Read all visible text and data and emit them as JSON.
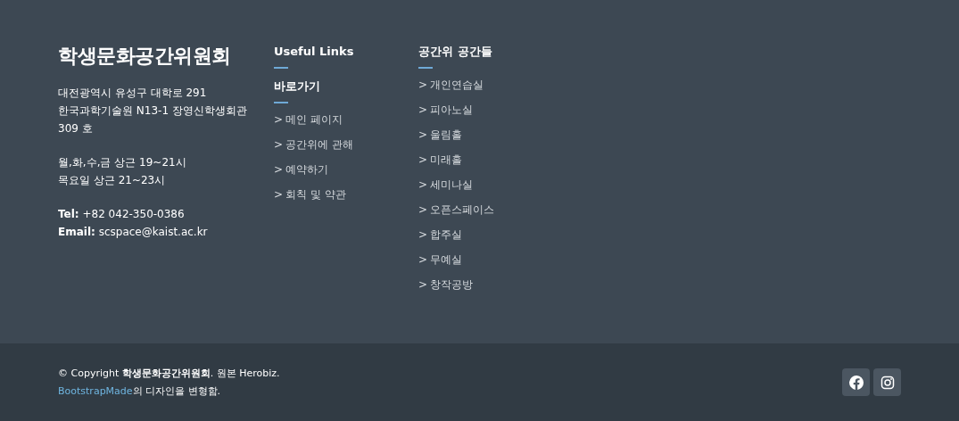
{
  "footer": {
    "brand": {
      "title": "학생문화공간위원회",
      "address": [
        "대전광역시 유성구 대학로 291",
        "한국과학기술원 N13-1 장영신학생회관 309 호"
      ],
      "hours": [
        "월,화,수,금 상근 19~21시",
        "목요일 상근 21~23시"
      ],
      "contacts": [
        {
          "label": "Tel:",
          "value": "+82 042-350-0386"
        },
        {
          "label": "Email:",
          "value": "scspace@kaist.ac.kr"
        }
      ]
    },
    "link_columns": [
      {
        "headings": [
          "Useful Links",
          "바로가기"
        ],
        "links": [
          {
            "icon": ">",
            "label": "메인 페이지"
          },
          {
            "icon": ">",
            "label": "공간위에 관해"
          },
          {
            "icon": ">",
            "label": "예약하기"
          },
          {
            "icon": ">",
            "label": "회칙 및 약관"
          }
        ]
      },
      {
        "headings": [
          "공간위 공간들"
        ],
        "links": [
          {
            "icon": ">",
            "label": "개인연습실"
          },
          {
            "icon": ">",
            "label": "피아노실"
          },
          {
            "icon": ">",
            "label": "울림홀"
          },
          {
            "icon": ">",
            "label": "미래홀"
          },
          {
            "icon": ">",
            "label": "세미나실"
          },
          {
            "icon": ">",
            "label": "오픈스페이스"
          },
          {
            "icon": ">",
            "label": "합주실"
          },
          {
            "icon": ">",
            "label": "무예실"
          },
          {
            "icon": ">",
            "label": "창작공방"
          }
        ]
      }
    ]
  },
  "bottom_bar": {
    "copyright": "© Copyright **학생문화공간위원회**. 원본 Herobiz.",
    "credit": {
      "link": "BootstrapMade",
      "text": "의 디자인을 변형함."
    },
    "social": [
      {
        "kind": "facebook"
      },
      {
        "kind": "instagram"
      }
    ]
  }
}
